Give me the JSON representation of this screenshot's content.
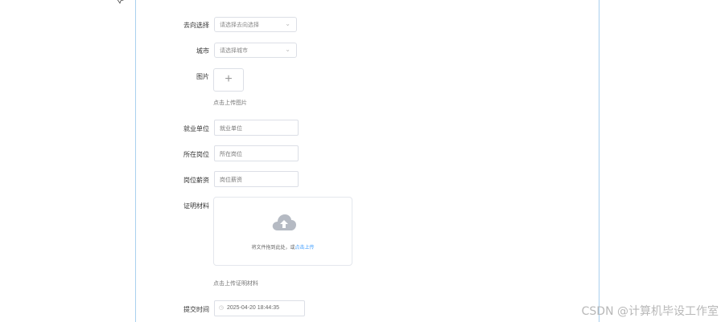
{
  "form": {
    "direction": {
      "label": "去向选择",
      "placeholder": "请选择去向选择"
    },
    "city": {
      "label": "城市",
      "placeholder": "请选择城市"
    },
    "image": {
      "label": "图片",
      "hint": "点击上传图片"
    },
    "employer": {
      "label": "就业单位",
      "placeholder": "就业单位"
    },
    "position": {
      "label": "所在岗位",
      "placeholder": "所在岗位"
    },
    "salary": {
      "label": "岗位薪资",
      "placeholder": "岗位薪资"
    },
    "proof": {
      "label": "证明材料",
      "drag_text": "将文件拖到此处，或",
      "drag_link": "点击上传",
      "hint": "点击上传证明材料"
    },
    "submit_time": {
      "label": "提交时间",
      "value": "2025-04-20 18:44:35"
    }
  },
  "icons": {
    "select_arrow": "chevron-down-icon",
    "upload": "plus-icon",
    "cloud": "cloud-upload-icon",
    "date": "clock-icon"
  },
  "colors": {
    "link": "#409eff",
    "border": "#dcdfe6",
    "frame_line": "#a9d0ef"
  },
  "watermark": "CSDN @计算机毕设工作室"
}
